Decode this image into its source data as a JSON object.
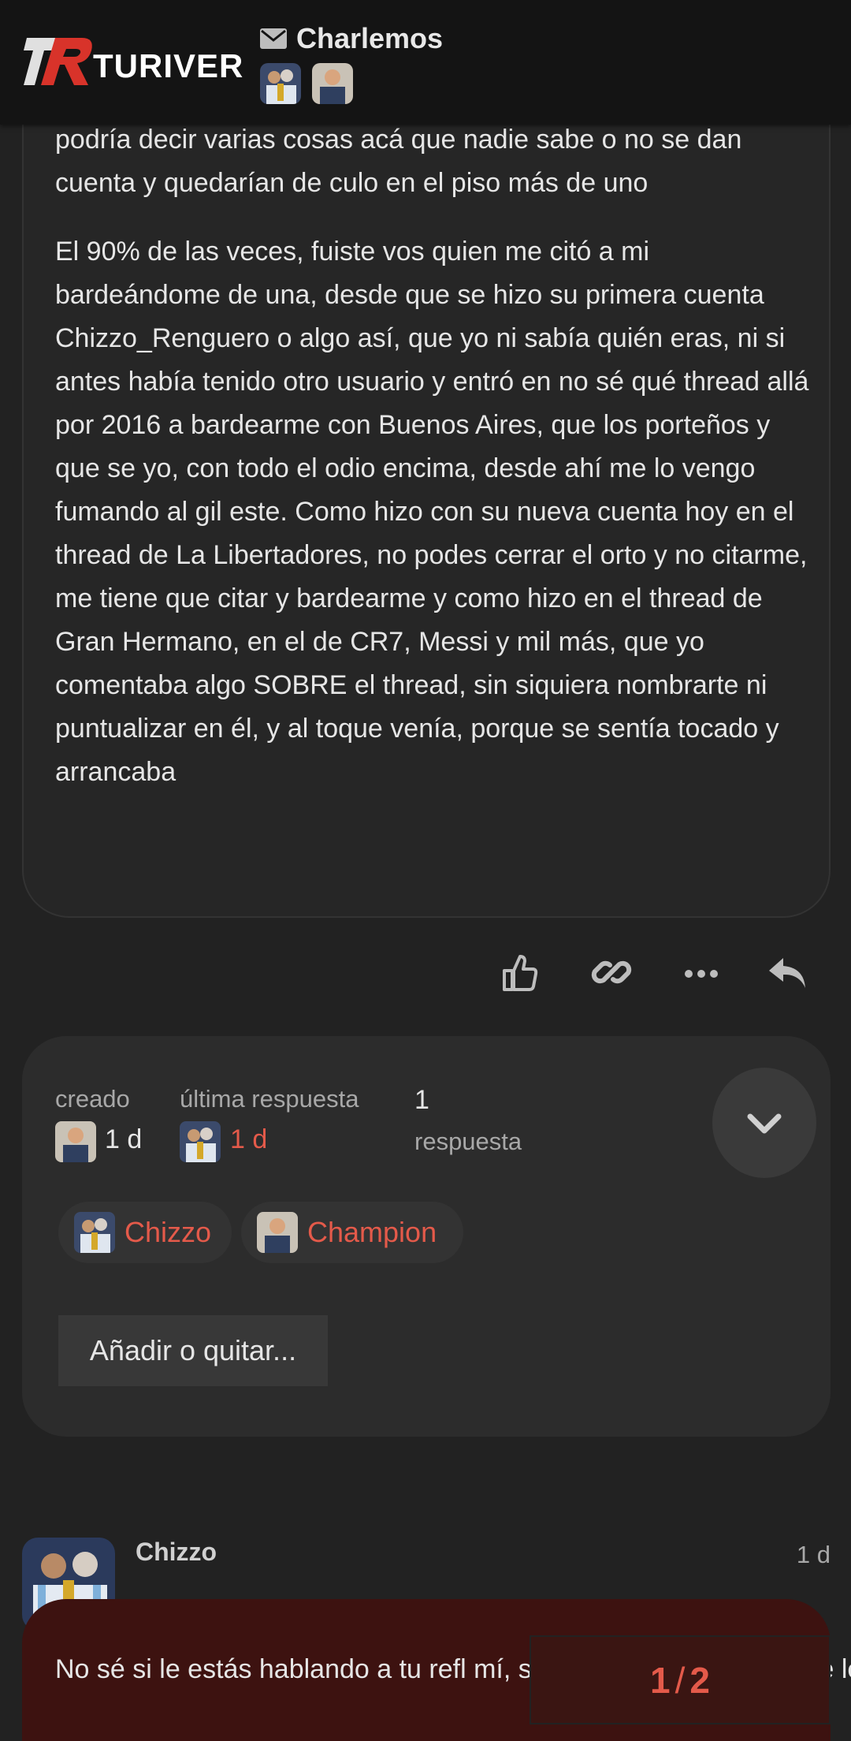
{
  "header": {
    "logo_text": "TURIVER",
    "topic_title": "Charlemos",
    "icons": {
      "mail": "envelope-icon"
    }
  },
  "post": {
    "paragraphs": [
      "podría decir varias cosas acá que nadie sabe o no se dan cuenta y quedarían de culo en el piso más de uno",
      "El 90% de las veces, fuiste vos quien me citó a mi bardeándome de una, desde que se hizo su primera cuenta Chizzo_Renguero o algo así, que yo ni sabía quién eras, ni si antes había tenido otro usuario y entró en no sé qué thread allá por 2016 a bardearme con Buenos Aires, que los porteños y que se yo, con todo el odio encima, desde ahí me lo vengo fumando al gil este. Como hizo con su nueva cuenta hoy en el thread de La Libertadores, no podes cerrar el orto y no citarme, me tiene que citar y bardearme y como hizo en el thread de Gran Hermano, en el de CR7, Messi y mil más, que yo comentaba algo SOBRE el thread, sin siquiera nombrarte ni puntualizar en él, y al toque venía, porque se sentía tocado y arrancaba"
    ],
    "actions": [
      "like-icon",
      "link-icon",
      "more-icon",
      "reply-icon"
    ]
  },
  "topic_map": {
    "created_label": "creado",
    "created_value": "1 d",
    "last_reply_label": "última respuesta",
    "last_reply_value": "1 d",
    "replies_count": "1",
    "replies_label": "respuesta",
    "participants": [
      "Chizzo",
      "Champion"
    ],
    "add_button": "Añadir o quitar..."
  },
  "next_post": {
    "username": "Chizzo",
    "date": "1 d",
    "text": "No sé si le estás hablando a tu refl mí, si copiaste el mensaje que le m"
  },
  "progress": {
    "current": "1",
    "separator": "/",
    "total": "2"
  },
  "colors": {
    "accent": "#e45a4a",
    "background": "#222222",
    "header": "#141414"
  }
}
